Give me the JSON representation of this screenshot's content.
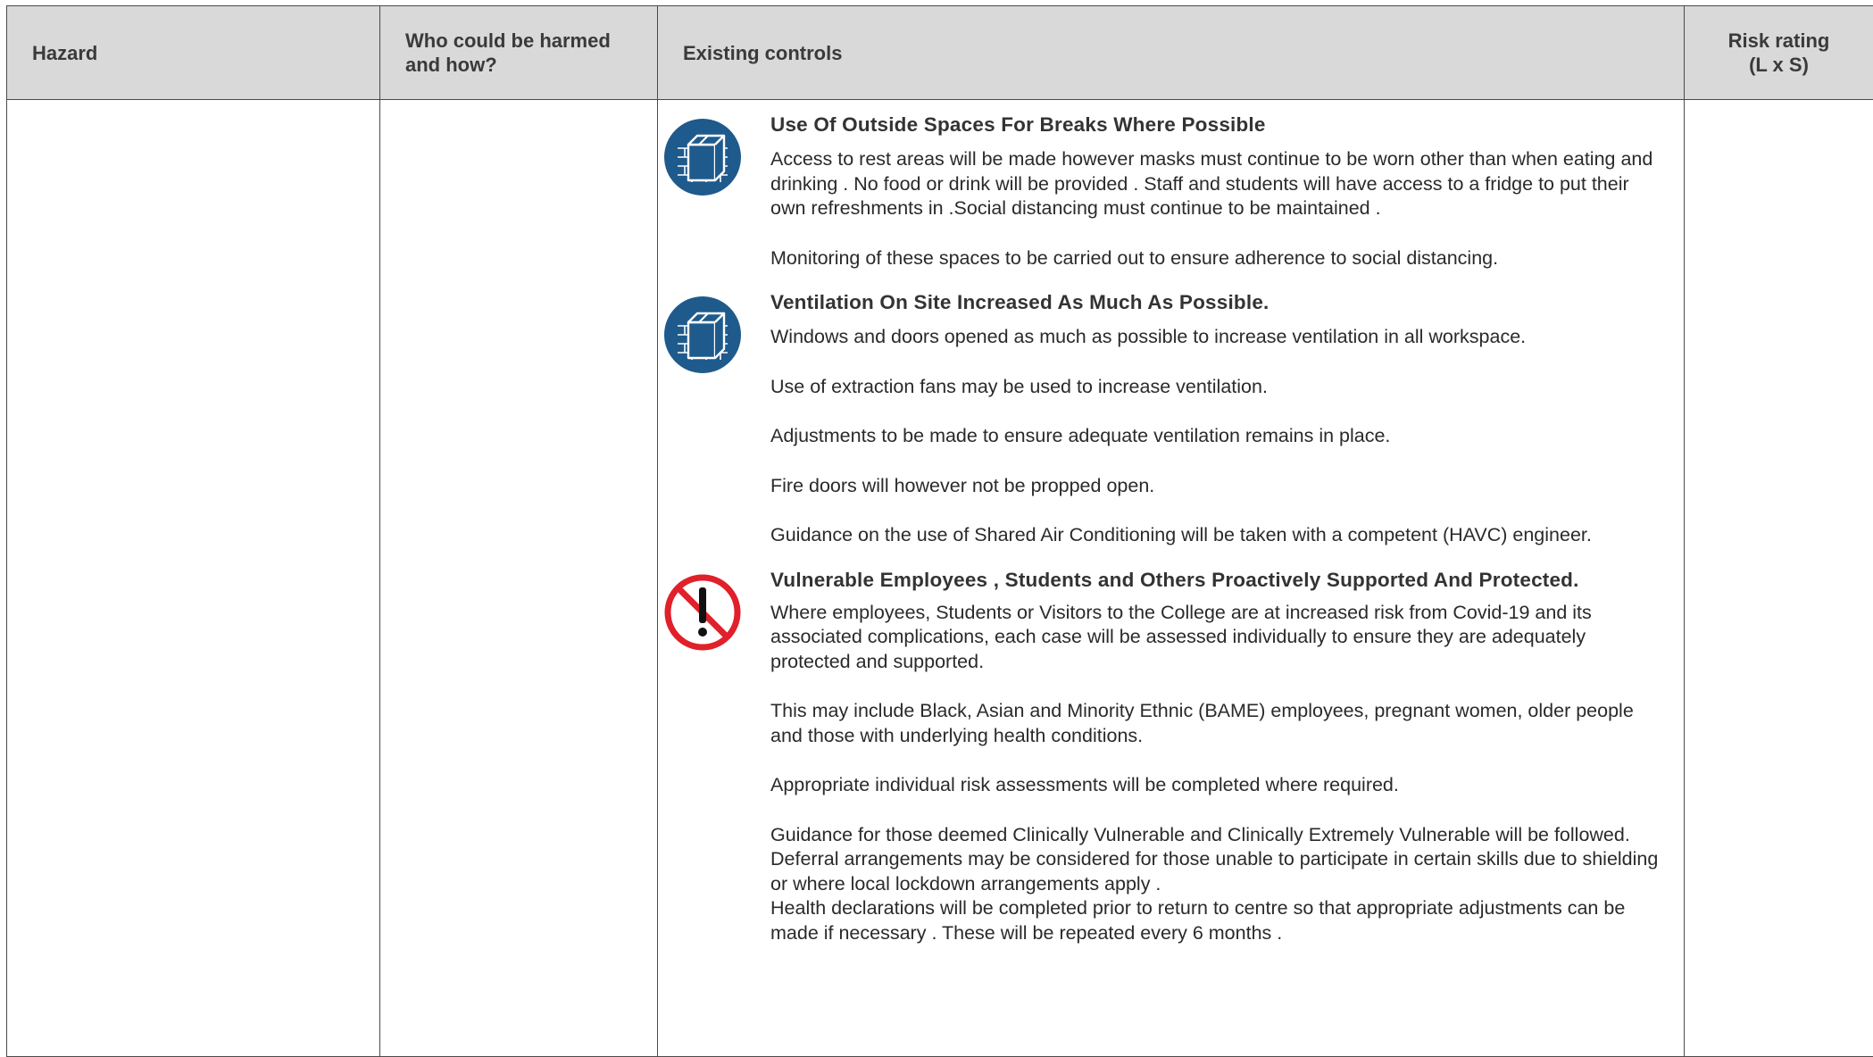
{
  "table": {
    "headers": {
      "hazard": "Hazard",
      "who": "Who could be harmed and how?",
      "controls": "Existing controls",
      "risk_line1": "Risk rating",
      "risk_line2": "(L x S)"
    }
  },
  "controls": [
    {
      "icon": "building-box-icon",
      "title": "Use Of Outside Spaces For Breaks Where Possible",
      "paragraphs": [
        "Access to rest areas will be made however masks must continue to be worn other than when eating and drinking . No food or drink will be provided . Staff and students will have access to a fridge to put their own refreshments in .Social distancing must continue to be maintained .",
        "Monitoring of these spaces to be carried out to ensure adherence to social distancing."
      ]
    },
    {
      "icon": "building-box-icon",
      "title": "Ventilation On Site Increased As Much As Possible.",
      "paragraphs": [
        "Windows and doors opened as much as possible to increase ventilation in all workspace.",
        "Use of extraction fans may be used to increase ventilation.",
        "Adjustments to be made to ensure adequate ventilation remains in place.",
        "Fire doors will however not be propped open.",
        "Guidance on the use of Shared Air Conditioning will be taken with a competent (HAVC) engineer."
      ]
    },
    {
      "icon": "prohibition-exclamation-icon",
      "title": "Vulnerable Employees , Students and Others Proactively Supported And Protected.",
      "paragraphs": [
        "Where employees, Students or Visitors to the College are at increased risk from Covid-19 and its associated complications, each case will be assessed individually to ensure they are adequately protected and supported.",
        "This may include Black, Asian and Minority Ethnic (BAME) employees, pregnant women, older people and those with underlying health conditions.",
        "Appropriate individual risk assessments will be completed where required."
      ],
      "tight_paragraphs": [
        "Guidance for those deemed Clinically Vulnerable and Clinically Extremely Vulnerable will be followed.",
        "Deferral arrangements may be considered for those unable to participate in certain skills due to shielding or where local lockdown arrangements apply .",
        "Health declarations will be completed prior to return to centre so that appropriate adjustments can be made if necessary . These will be repeated every 6 months ."
      ]
    }
  ],
  "colors": {
    "header_bg": "#d9d9d9",
    "border": "#4a4a4a",
    "mandatory_blue": "#1f5a8c",
    "prohibition_red": "#e0202a"
  }
}
